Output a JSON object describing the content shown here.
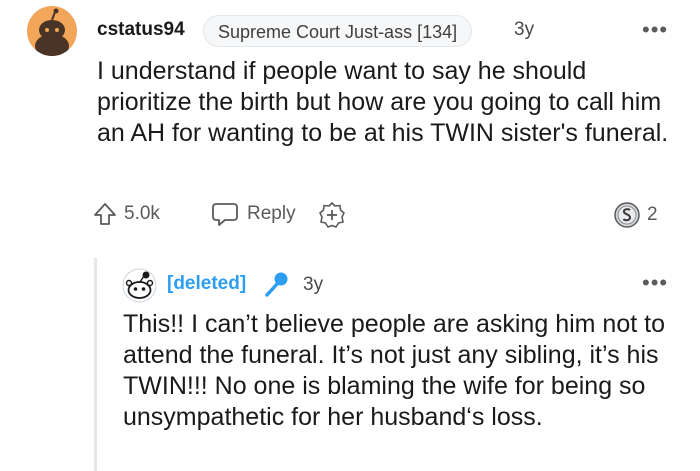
{
  "comment": {
    "author": "cstatus94",
    "flair": "Supreme Court Just-ass [134]",
    "age": "3y",
    "more": "•••",
    "body": "I understand if people want to say he should prioritize the birth but how are you going to call him an AH for wanting to be at his TWIN sister's funeral.",
    "upvotes": "5.0k",
    "reply_label": "Reply",
    "award_count": "2"
  },
  "reply": {
    "author": "[deleted]",
    "age": "3y",
    "more": "•••",
    "body": "This!! I can’t believe people are asking him not to attend the funeral. It’s not just any sibling, it’s his TWIN!!! No one is blaming the wife for being so unsympathetic for her husband‘s loss."
  },
  "colors": {
    "deleted_author": "#2e9ef2",
    "avatar_orange": "#f2a65a",
    "mic_blue": "#2e9ef2"
  },
  "icons": [
    "snoo-avatar-icon",
    "upvote-arrow-icon",
    "reply-bubble-icon",
    "award-plus-icon",
    "silver-award-icon",
    "snoo-deleted-avatar-icon",
    "microphone-icon"
  ]
}
